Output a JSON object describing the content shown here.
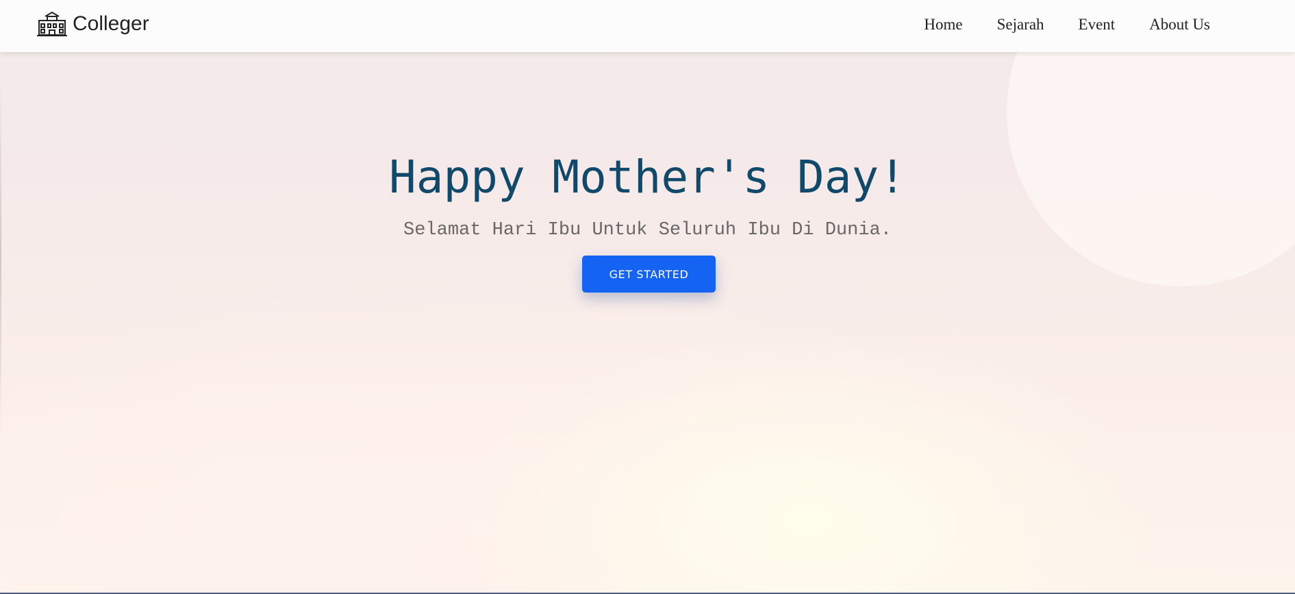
{
  "header": {
    "brand_name": "Colleger",
    "brand_icon": "college-building-icon",
    "nav": [
      {
        "label": "Home"
      },
      {
        "label": "Sejarah"
      },
      {
        "label": "Event"
      },
      {
        "label": "About Us"
      }
    ]
  },
  "hero": {
    "title": "Happy Mother's Day!",
    "subtitle": "Selamat Hari Ibu Untuk Seluruh Ibu Di Dunia.",
    "cta_label": "GET STARTED"
  },
  "colors": {
    "title": "#11496b",
    "cta": "#1463f3",
    "subtitle": "#6a6767"
  }
}
